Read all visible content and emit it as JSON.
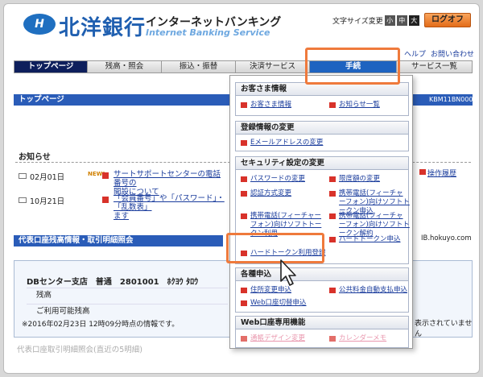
{
  "header": {
    "logo_glyph": "H",
    "bank_name": "北洋銀行",
    "ib_title": "インターネットバンキング",
    "ib_subtitle": "Internet Banking Service",
    "font_size_label": "文字サイズ変更",
    "font_small": "小",
    "font_medium": "中",
    "font_large": "大",
    "logout": "ログオフ",
    "help": "ヘルプ",
    "contact": "お問い合わせ"
  },
  "nav": {
    "tabs": [
      {
        "label": "トップページ"
      },
      {
        "label": "残高・照会"
      },
      {
        "label": "振込・振替"
      },
      {
        "label": "決済サービス"
      },
      {
        "label": "手続"
      },
      {
        "label": "サービス一覧"
      }
    ]
  },
  "page": {
    "title": "トップページ",
    "id": "KBM11BN000B"
  },
  "notices": {
    "title": "お知らせ",
    "items": [
      {
        "date": "02月01日",
        "badge": "NEW!",
        "text1": "サートサポートセンターの電話番号の",
        "text2": "開設について"
      },
      {
        "date": "10月21日",
        "badge": "",
        "text1": "「会員番号」や「パスワード」・「乱数表」",
        "text2": "ます"
      }
    ],
    "history_link": "操作履歴",
    "domain_note": "IB.hokuyo.com"
  },
  "account": {
    "section_title": "代表口座残高情報・取引明細照会",
    "name": "DBセンター支店　普通　2801001　ﾎｸﾖｳ ﾀﾛｳ",
    "balance_label": "残高",
    "available_label": "ご利用可能残高",
    "as_of": "※2016年02月23日 12時09分時点の情報です。",
    "right_note": "表示されていません",
    "sub_section": "代表口座取引明細照会(直近の5明細)"
  },
  "dropdown": {
    "customer": {
      "title": "お客さま情報",
      "items": [
        "お客さま情報",
        "お知らせ一覧"
      ]
    },
    "registration": {
      "title": "登録情報の変更",
      "items": [
        "Eメールアドレスの変更"
      ]
    },
    "security": {
      "title": "セキュリティ設定の変更",
      "items": [
        "パスワードの変更",
        "限度額の変更",
        "認証方式変更",
        "携帯電話(フィーチャーフォン)向けソフトトークン申込",
        "携帯電話(フィーチャーフォン)向けソフトトークン利用",
        "携帯電話(フィーチャーフォン)向けソフトトークン解約",
        "ハードトークン申込",
        "ハードトークン利用登録"
      ]
    },
    "applications": {
      "title": "各種申込",
      "items": [
        "住所変更申込",
        "公共料金自動支払申込",
        "Web口座切替申込"
      ]
    },
    "web_account": {
      "title": "Web口座専用機能",
      "items": [
        "通帳デザイン変更",
        "カレンダーメモ"
      ]
    }
  },
  "colors": {
    "brand_blue": "#1f5fb0",
    "nav_active": "#0e1f5c",
    "nav_highlight": "#1e63c0",
    "section_blue": "#2a5cb8",
    "highlight_orange": "#ef7a3c",
    "logout_orange": "#e36c1a",
    "link": "#1a3c9c"
  }
}
